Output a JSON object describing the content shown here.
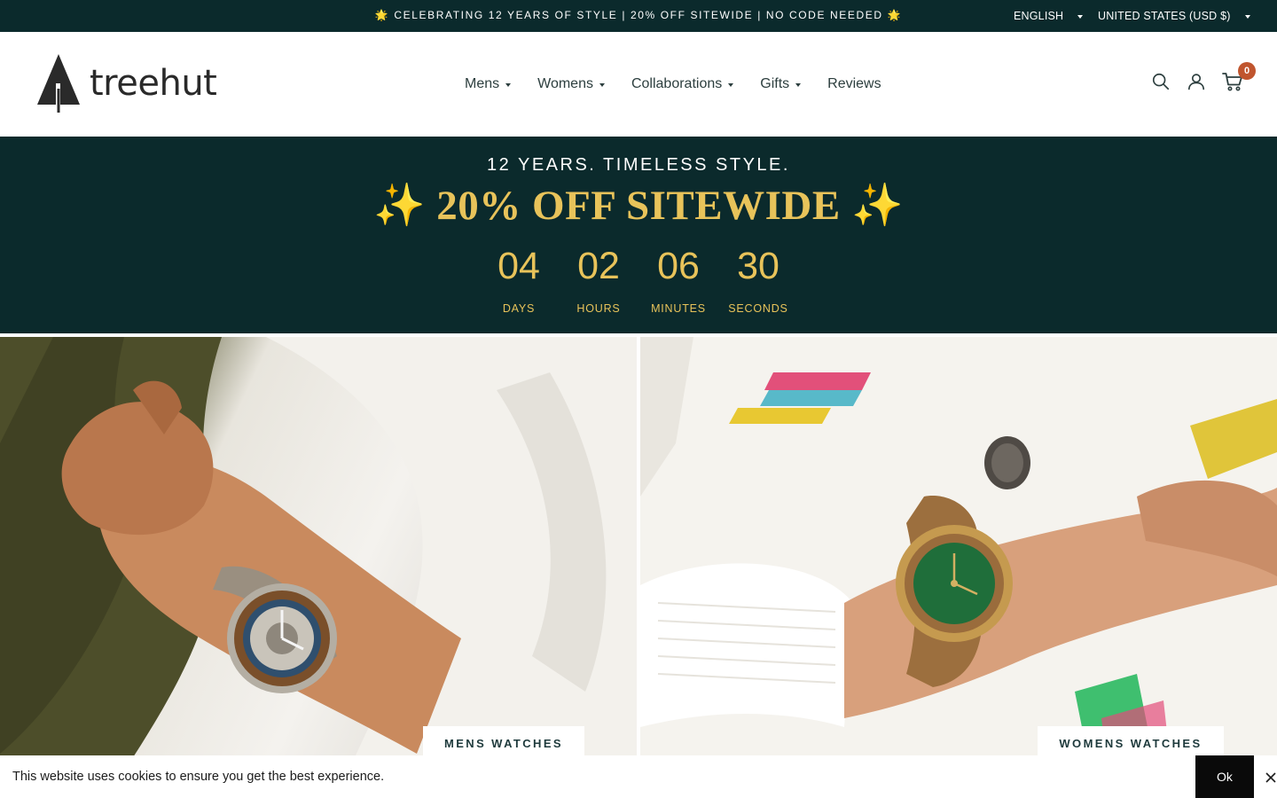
{
  "announcement": {
    "star_left": "🌟",
    "text": "CELEBRATING 12 YEARS OF STYLE | 20% OFF SITEWIDE | NO CODE NEEDED",
    "star_right": "🌟",
    "language": "ENGLISH",
    "currency": "UNITED STATES (USD $)"
  },
  "header": {
    "logo_text": "treehut",
    "nav": [
      {
        "label": "Mens",
        "has_dropdown": true
      },
      {
        "label": "Womens",
        "has_dropdown": true
      },
      {
        "label": "Collaborations",
        "has_dropdown": true
      },
      {
        "label": "Gifts",
        "has_dropdown": true
      },
      {
        "label": "Reviews",
        "has_dropdown": false
      }
    ],
    "icons": [
      "search-icon",
      "account-icon",
      "cart-icon"
    ],
    "cart_count": "0"
  },
  "promo": {
    "subtitle": "12 YEARS. TIMELESS STYLE.",
    "title": "✨ 20% OFF SITEWIDE ✨",
    "countdown": [
      {
        "value": "04",
        "label": "DAYS"
      },
      {
        "value": "02",
        "label": "HOURS"
      },
      {
        "value": "06",
        "label": "MINUTES"
      },
      {
        "value": "30",
        "label": "SECONDS"
      }
    ]
  },
  "hero": {
    "left_button": "MENS WATCHES",
    "right_button": "WOMENS WATCHES"
  },
  "cookie": {
    "text": "This website uses cookies to ensure you get the best experience.",
    "ok_label": "Ok"
  },
  "colors": {
    "dark_teal": "#0b2a2c",
    "gold": "#e8c35a",
    "cart_badge": "#c0552e"
  }
}
